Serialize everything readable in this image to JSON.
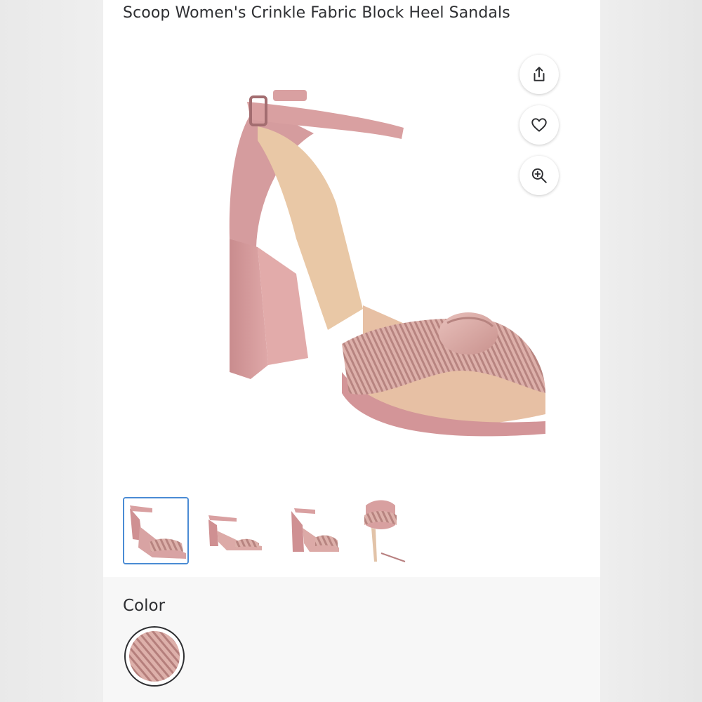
{
  "product": {
    "title": "Scoop Women's Crinkle Fabric Block Heel Sandals"
  },
  "actions": [
    {
      "name": "share-button",
      "icon": "share-icon"
    },
    {
      "name": "favorite-button",
      "icon": "heart-icon"
    },
    {
      "name": "zoom-button",
      "icon": "zoom-in-icon"
    }
  ],
  "gallery": {
    "thumbnail_count": 4,
    "selected_index": 0
  },
  "color": {
    "label": "Color",
    "selected": "Blush pink crinkle",
    "swatch_color": "#d9a3a2"
  },
  "colors": {
    "accent_selected": "#4a8bd4",
    "text": "#2e2f32",
    "sandal_pink": "#d49a9a"
  }
}
